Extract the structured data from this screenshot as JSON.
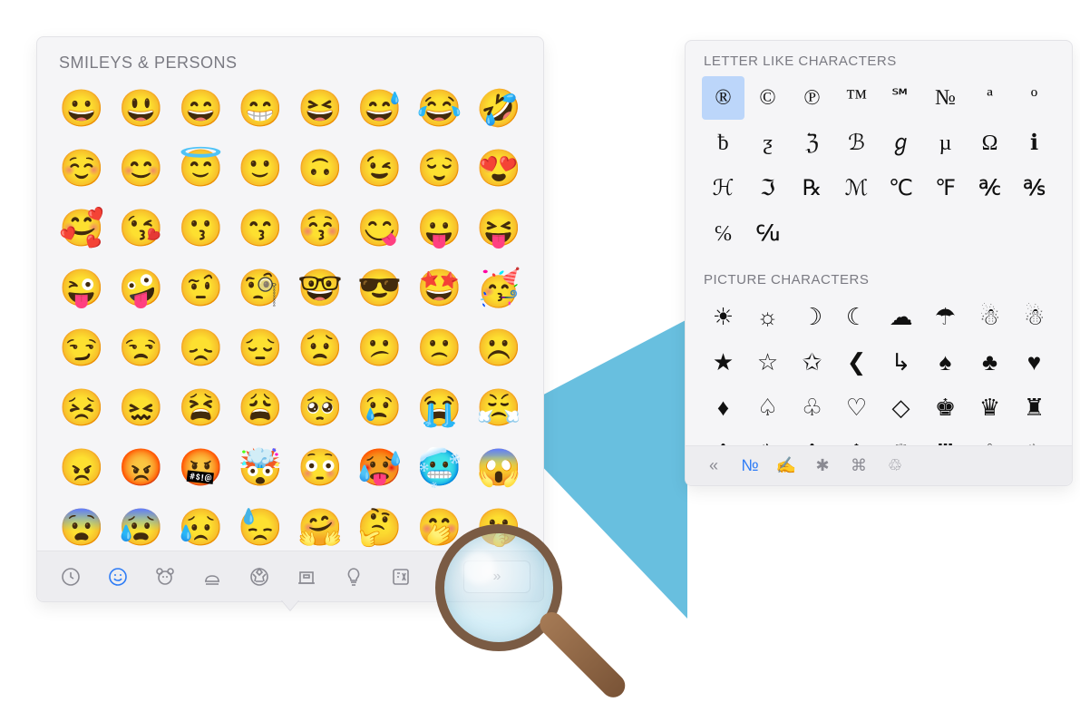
{
  "emoji_panel": {
    "title": "SMILEYS & PERSONS",
    "emojis": [
      "😀",
      "😃",
      "😄",
      "😁",
      "😆",
      "😅",
      "😂",
      "🤣",
      "☺️",
      "😊",
      "😇",
      "🙂",
      "🙃",
      "😉",
      "😌",
      "😍",
      "🥰",
      "😘",
      "😗",
      "😙",
      "😚",
      "😋",
      "😛",
      "😝",
      "😜",
      "🤪",
      "🤨",
      "🧐",
      "🤓",
      "😎",
      "🤩",
      "🥳",
      "😏",
      "😒",
      "😞",
      "😔",
      "😟",
      "😕",
      "🙁",
      "☹️",
      "😣",
      "😖",
      "😫",
      "😩",
      "🥺",
      "😢",
      "😭",
      "😤",
      "😠",
      "😡",
      "🤬",
      "🤯",
      "😳",
      "🥵",
      "🥶",
      "😱",
      "😨",
      "😰",
      "😥",
      "😓",
      "🤗",
      "🤔",
      "🤭",
      "🤫"
    ],
    "toolbar": [
      {
        "name": "recent-icon",
        "label": "Recent"
      },
      {
        "name": "smileys-icon",
        "label": "Smileys",
        "active": true
      },
      {
        "name": "animals-icon",
        "label": "Animals"
      },
      {
        "name": "food-icon",
        "label": "Food"
      },
      {
        "name": "activity-icon",
        "label": "Activity"
      },
      {
        "name": "travel-icon",
        "label": "Travel"
      },
      {
        "name": "objects-icon",
        "label": "Objects"
      },
      {
        "name": "symbols-icon",
        "label": "Symbols"
      }
    ],
    "more_label": "»"
  },
  "char_panel": {
    "letter_title": "LETTER LIKE CHARACTERS",
    "letters": [
      "®",
      "©",
      "℗",
      "™",
      "℠",
      "№",
      "ª",
      "º",
      "ƀ",
      "ƺ",
      "ℨ",
      "ℬ",
      "ℊ",
      "µ",
      "Ω",
      "ℹ",
      "ℋ",
      "ℑ",
      "℞",
      "ℳ",
      "℃",
      "℉",
      "℀",
      "℁",
      "℅",
      "℆",
      "",
      "",
      "",
      "",
      "",
      ""
    ],
    "selected_index": 0,
    "picture_title": "PICTURE CHARACTERS",
    "pictures": [
      "☀",
      "☼",
      "☽",
      "☾",
      "☁",
      "☂",
      "☃",
      "☃",
      "★",
      "☆",
      "✩",
      "❮",
      "↳",
      "♠",
      "♣",
      "♥",
      "♦",
      "♤",
      "♧",
      "♡",
      "◇",
      "♚",
      "♛",
      "♜",
      "♝",
      "♞",
      "♟",
      "♔",
      "♕",
      "♖",
      "♗",
      "♘"
    ],
    "toolbar": [
      {
        "name": "collapse-icon",
        "glyph": "«"
      },
      {
        "name": "number-icon",
        "glyph": "№",
        "active": true
      },
      {
        "name": "signature-icon",
        "glyph": "✍"
      },
      {
        "name": "asterisk-icon",
        "glyph": "✱"
      },
      {
        "name": "command-icon",
        "glyph": "⌘"
      },
      {
        "name": "recycle-icon",
        "glyph": "♲"
      }
    ]
  }
}
